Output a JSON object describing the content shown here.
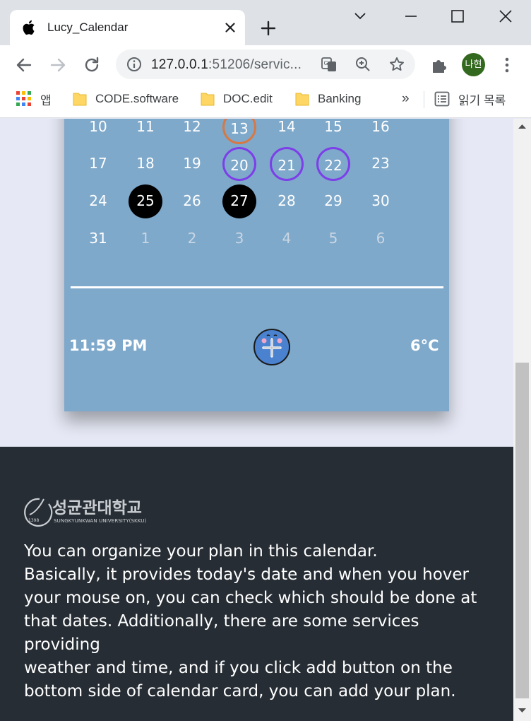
{
  "browser": {
    "tab_title": "Lucy_Calendar",
    "url_host": "127.0.0.1",
    "url_rest": ":51206/servic...",
    "profile_initials": "나현",
    "bookmarks": [
      {
        "label": "앱",
        "icon": "apps-grid-icon"
      },
      {
        "label": "CODE.software",
        "icon": "folder-icon"
      },
      {
        "label": "DOC.edit",
        "icon": "folder-icon"
      },
      {
        "label": "Banking",
        "icon": "folder-icon"
      }
    ],
    "overflow_label": "»",
    "reading_list_label": "읽기 목록"
  },
  "calendar": {
    "weeks": [
      [
        {
          "d": "10"
        },
        {
          "d": "11"
        },
        {
          "d": "12"
        },
        {
          "d": "13",
          "s": "today"
        },
        {
          "d": "14"
        },
        {
          "d": "15"
        },
        {
          "d": "16"
        }
      ],
      [
        {
          "d": "17"
        },
        {
          "d": "18"
        },
        {
          "d": "19"
        },
        {
          "d": "20",
          "s": "week"
        },
        {
          "d": "21",
          "s": "week"
        },
        {
          "d": "22",
          "s": "week"
        },
        {
          "d": "23"
        }
      ],
      [
        {
          "d": "24"
        },
        {
          "d": "25",
          "s": "event"
        },
        {
          "d": "26"
        },
        {
          "d": "27",
          "s": "event"
        },
        {
          "d": "28"
        },
        {
          "d": "29"
        },
        {
          "d": "30"
        }
      ],
      [
        {
          "d": "31"
        },
        {
          "d": "1",
          "s": "faded"
        },
        {
          "d": "2",
          "s": "faded"
        },
        {
          "d": "3",
          "s": "faded"
        },
        {
          "d": "4",
          "s": "faded"
        },
        {
          "d": "5",
          "s": "faded"
        },
        {
          "d": "6",
          "s": "faded"
        }
      ]
    ],
    "time": "11:59 PM",
    "temperature": "6°C",
    "colors": {
      "card": "#7fa9cb",
      "today_ring": "#d77845",
      "week_ring": "#7d3fe8",
      "event_fill": "#000000"
    }
  },
  "footer": {
    "logo_text": "성균관대학교",
    "logo_subtext": "SUNGKYUNKWAN UNIVERSITY(SKKU)",
    "logo_year": "1398",
    "description_lines": [
      "You can organize your plan in this calendar.",
      "Basically, it provides today's date and when you hover",
      "your mouse on, you can check which should be done at",
      "that dates. Additionally, there are some services providing",
      "weather and time, and if you click add button on the",
      "bottom side of calendar card, you can add your plan."
    ]
  }
}
